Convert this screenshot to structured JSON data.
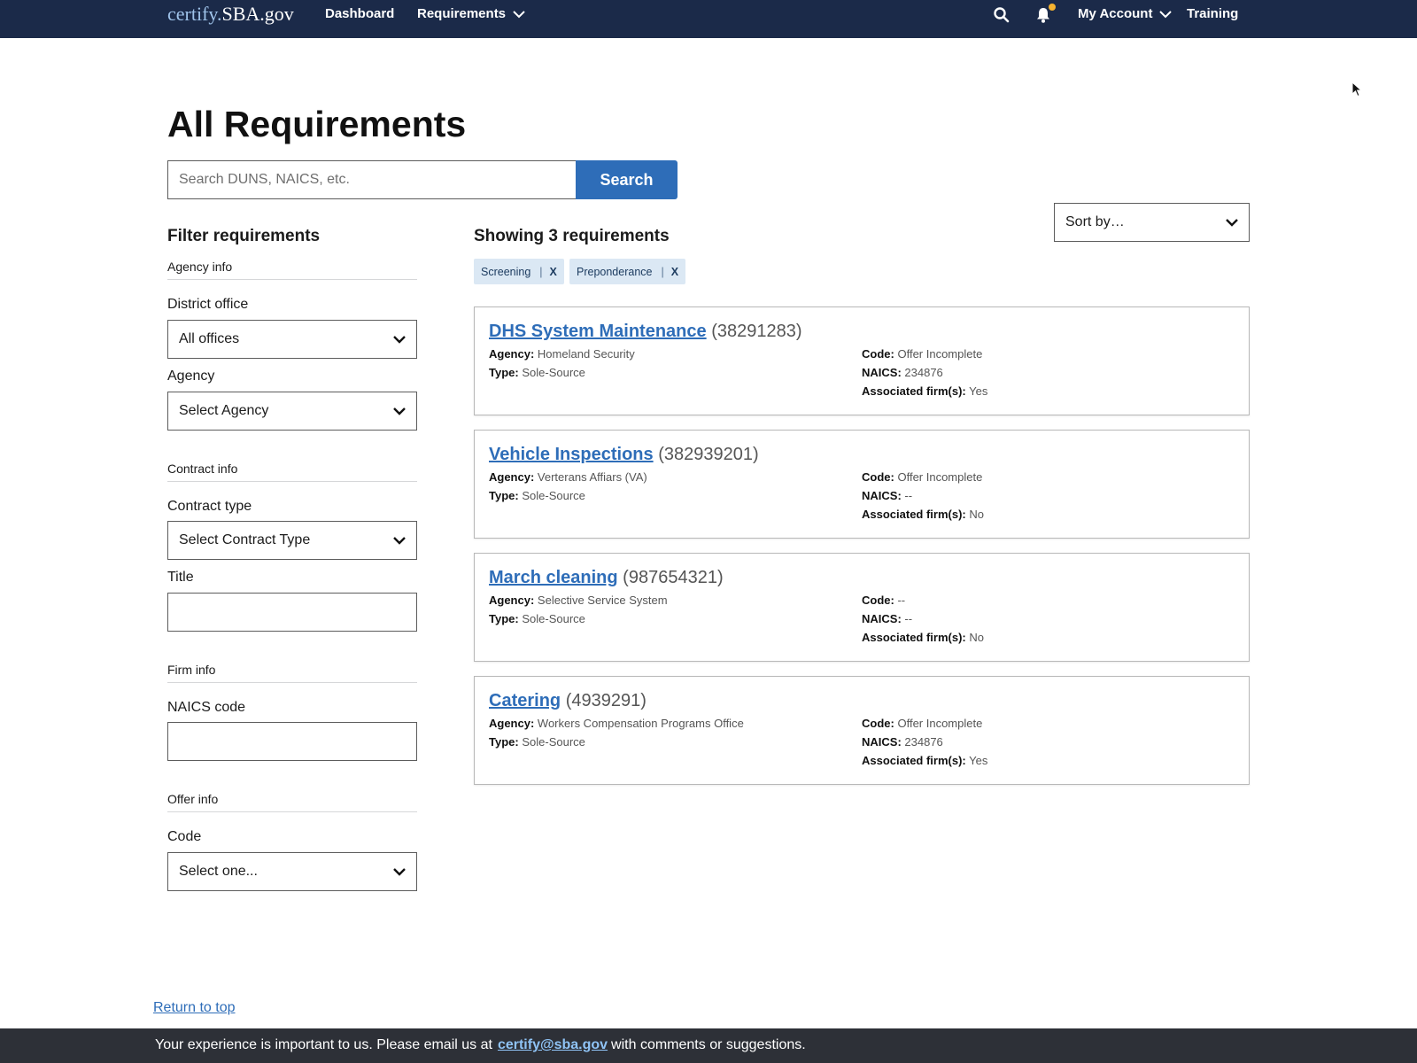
{
  "header": {
    "logo_prefix": "certify.",
    "logo_suffix": "SBA.gov",
    "nav": [
      {
        "label": "Dashboard"
      },
      {
        "label": "Requirements"
      }
    ],
    "account_label": "My Account",
    "training_label": "Training",
    "icons": [
      "search-icon",
      "bell-icon",
      "chevron-down-icon"
    ],
    "notification_dot_color": "#f5b330"
  },
  "page": {
    "title": "All Requirements"
  },
  "search": {
    "placeholder": "Search DUNS, NAICS, etc.",
    "value": "",
    "button_label": "Search"
  },
  "filters": {
    "heading": "Filter requirements",
    "agency_section": "Agency info",
    "district_office_label": "District office",
    "district_office_value": "All offices",
    "agency_label": "Agency",
    "agency_value": "Select Agency",
    "contract_section": "Contract info",
    "contract_type_label": "Contract type",
    "contract_type_value": "Select Contract Type",
    "title_label": "Title",
    "firm_section": "Firm info",
    "naics_label": "NAICS code",
    "offer_section": "Offer info",
    "code_label": "Code",
    "code_value": "Select one..."
  },
  "results": {
    "heading": "Showing 3 requirements",
    "sort_value": "Sort by…",
    "tags": [
      {
        "label": "Screening",
        "sep": "|",
        "remove": "X"
      },
      {
        "label": "Preponderance",
        "sep": "|",
        "remove": "X"
      }
    ],
    "field_labels": {
      "agency": "Agency:",
      "type": "Type:",
      "code": "Code:",
      "naics": "NAICS:",
      "firms": "Associated firm(s):"
    },
    "items": [
      {
        "title": "DHS System Maintenance",
        "id": "(38291283)",
        "agency": "Homeland Security",
        "type": "Sole-Source",
        "code": "Offer Incomplete",
        "naics": "234876",
        "firms": "Yes"
      },
      {
        "title": "Vehicle Inspections",
        "id": "(382939201)",
        "agency": "Verterans Affiars (VA)",
        "type": "Sole-Source",
        "code": "Offer Incomplete",
        "naics": "--",
        "firms": "No"
      },
      {
        "title": "March cleaning",
        "id": "(987654321)",
        "agency": "Selective Service System",
        "type": "Sole-Source",
        "code": "--",
        "naics": "--",
        "firms": "No"
      },
      {
        "title": "Catering",
        "id": "(4939291)",
        "agency": "Workers Compensation Programs Office",
        "type": "Sole-Source",
        "code": "Offer Incomplete",
        "naics": "234876",
        "firms": "Yes"
      }
    ]
  },
  "footer": {
    "return_top": "Return to top",
    "text_before": "Your experience is important to us. Please email us at",
    "email": "certify@sba.gov",
    "text_after": "with comments or suggestions."
  },
  "colors": {
    "nav_bg": "#1b2a49",
    "primary": "#2e6db8",
    "footer_bg": "#2d3037",
    "tag_bg": "#dbe8f4"
  }
}
